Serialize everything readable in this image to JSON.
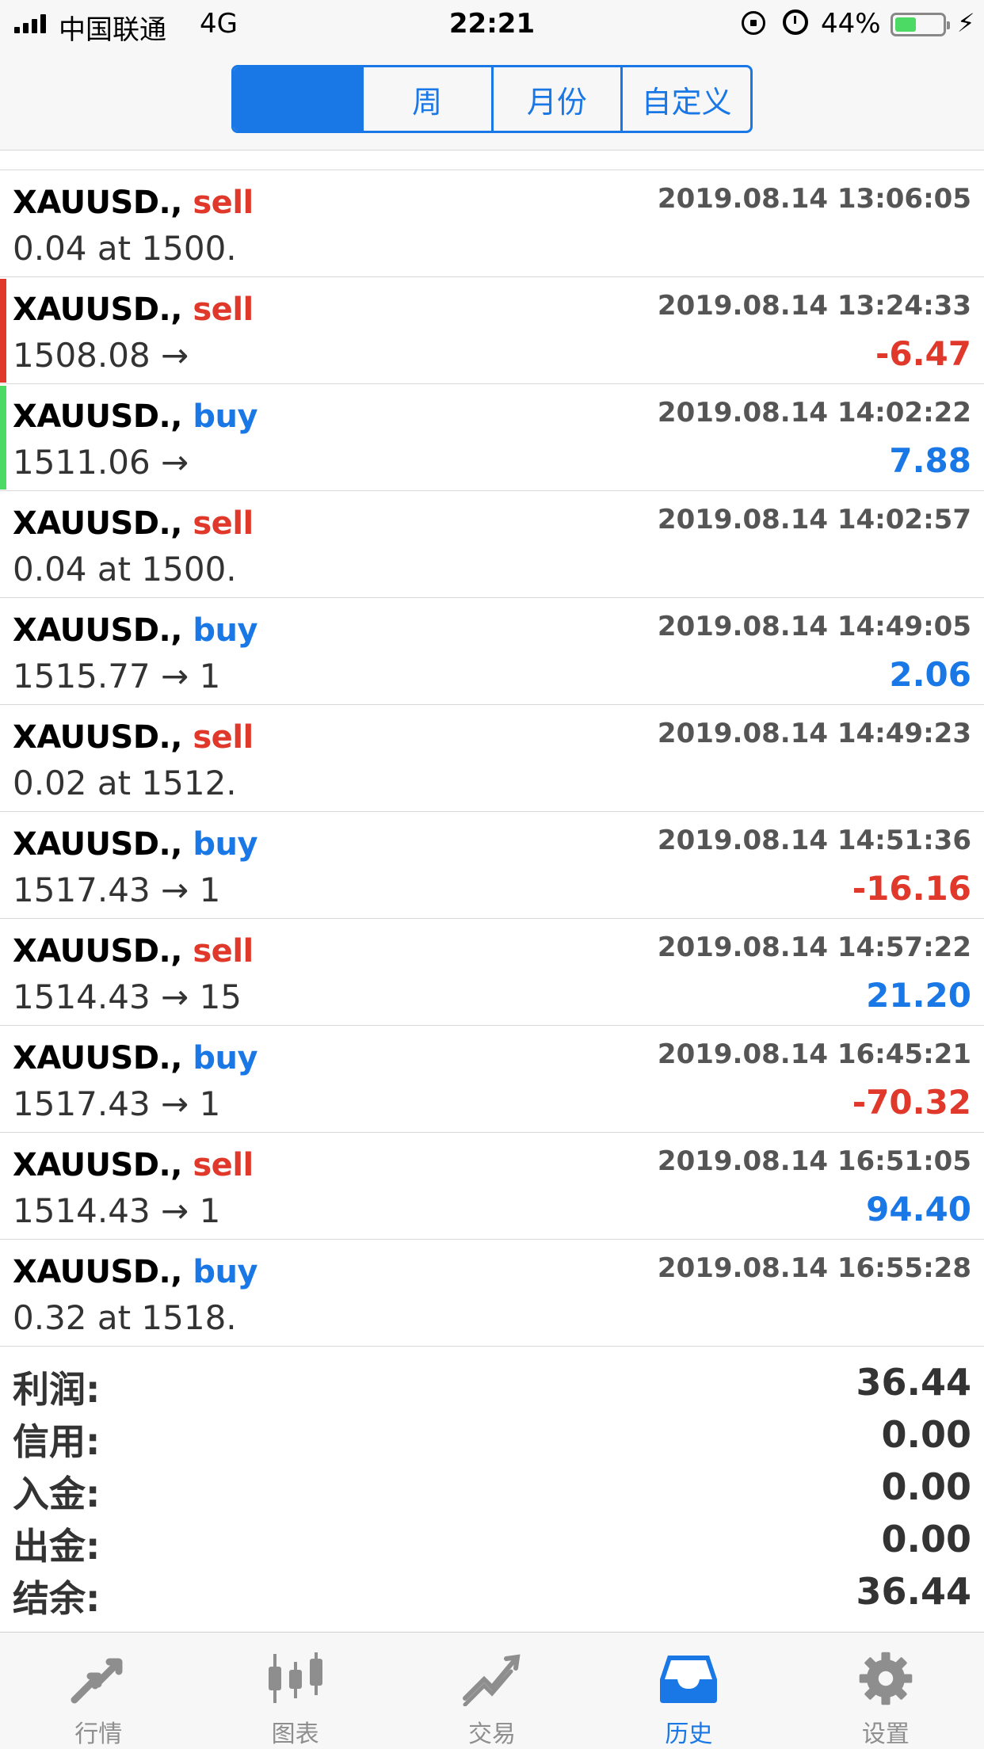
{
  "status_bar": {
    "carrier": "中国联通",
    "network": "4G",
    "time": "22:21",
    "battery_percent": "44%"
  },
  "period_tabs": [
    "",
    "周",
    "月份",
    "自定义"
  ],
  "trades": [
    {
      "symbol": "XAUUSD.,",
      "side": "sell",
      "time": "2019.08.14 13:06:05",
      "detail": "0.04 at 1500.",
      "profit": "",
      "accent": ""
    },
    {
      "symbol": "XAUUSD.,",
      "side": "sell",
      "time": "2019.08.14 13:24:33",
      "detail": "1508.08 →",
      "profit": "-6.47",
      "accent": "#e0392b"
    },
    {
      "symbol": "XAUUSD.,",
      "side": "buy",
      "time": "2019.08.14 14:02:22",
      "detail": "1511.06 →",
      "profit": "7.88",
      "accent": "#4cd964"
    },
    {
      "symbol": "XAUUSD.,",
      "side": "sell",
      "time": "2019.08.14 14:02:57",
      "detail": "0.04 at 1500.",
      "profit": "",
      "accent": ""
    },
    {
      "symbol": "XAUUSD.,",
      "side": "buy",
      "time": "2019.08.14 14:49:05",
      "detail": "1515.77 → 1",
      "profit": "2.06",
      "accent": ""
    },
    {
      "symbol": "XAUUSD.,",
      "side": "sell",
      "time": "2019.08.14 14:49:23",
      "detail": "0.02 at 1512.",
      "profit": "",
      "accent": ""
    },
    {
      "symbol": "XAUUSD.,",
      "side": "buy",
      "time": "2019.08.14 14:51:36",
      "detail": "1517.43 → 1",
      "profit": "-16.16",
      "accent": ""
    },
    {
      "symbol": "XAUUSD.,",
      "side": "sell",
      "time": "2019.08.14 14:57:22",
      "detail": "1514.43 → 15",
      "profit": "21.20",
      "accent": ""
    },
    {
      "symbol": "XAUUSD.,",
      "side": "buy",
      "time": "2019.08.14 16:45:21",
      "detail": "1517.43 → 1",
      "profit": "-70.32",
      "accent": ""
    },
    {
      "symbol": "XAUUSD.,",
      "side": "sell",
      "time": "2019.08.14 16:51:05",
      "detail": "1514.43 → 1",
      "profit": "94.40",
      "accent": ""
    },
    {
      "symbol": "XAUUSD.,",
      "side": "buy",
      "time": "2019.08.14 16:55:28",
      "detail": "0.32 at 1518.",
      "profit": "",
      "accent": ""
    }
  ],
  "summary": [
    {
      "label": "利润:",
      "value": "36.44"
    },
    {
      "label": "信用:",
      "value": "0.00"
    },
    {
      "label": "入金:",
      "value": "0.00"
    },
    {
      "label": "出金:",
      "value": "0.00"
    },
    {
      "label": "结余:",
      "value": "36.44"
    }
  ],
  "tabbar": [
    {
      "label": "行情",
      "icon": "quotes-arrows-icon"
    },
    {
      "label": "图表",
      "icon": "candlestick-chart-icon"
    },
    {
      "label": "交易",
      "icon": "trade-trend-icon"
    },
    {
      "label": "历史",
      "icon": "history-inbox-icon"
    },
    {
      "label": "设置",
      "icon": "settings-gear-icon"
    }
  ],
  "colors": {
    "accent_blue": "#1a78e6",
    "sell_red": "#e0392b",
    "buy_blue": "#1a78e6",
    "gain_green": "#4cd964",
    "inactive_gray": "#8e8e8e"
  }
}
